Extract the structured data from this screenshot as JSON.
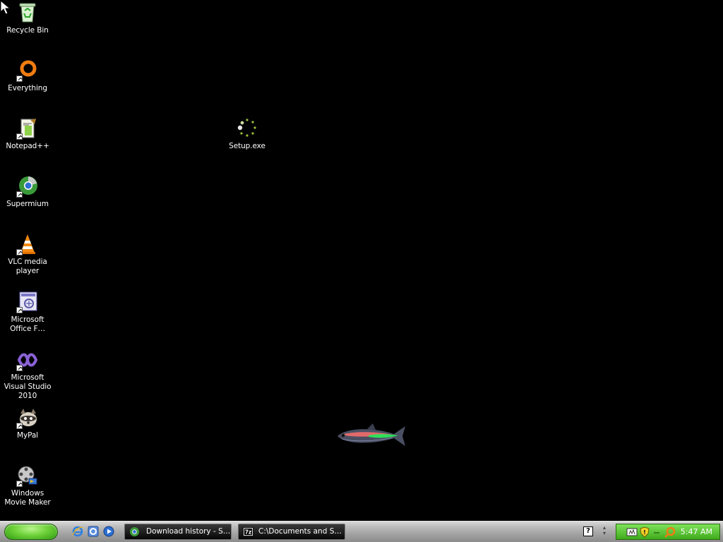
{
  "desktop": {
    "icons": [
      {
        "label": "Recycle Bin",
        "icon": "recycle-bin-icon"
      },
      {
        "label": "Everything",
        "icon": "everything-search-icon"
      },
      {
        "label": "Notepad++",
        "icon": "notepad-plus-plus-icon"
      },
      {
        "label": "Supermium",
        "icon": "supermium-browser-icon"
      },
      {
        "label": "VLC media player",
        "icon": "vlc-cone-icon"
      },
      {
        "label": "Microsoft Office F…",
        "icon": "office-frontpage-icon"
      },
      {
        "label": "Microsoft Visual Studio 2010",
        "icon": "visual-studio-icon"
      },
      {
        "label": "MyPal",
        "icon": "mypal-browser-icon"
      },
      {
        "label": "Windows Movie Maker",
        "icon": "movie-maker-icon"
      },
      {
        "label": "Setup.exe",
        "icon": "loading-spinner-icon"
      }
    ],
    "wallpaper": "neon-tetra-fish"
  },
  "taskbar": {
    "quick_launch": [
      "internet-explorer-icon",
      "ie-settings-icon",
      "media-player-icon"
    ],
    "buttons": [
      {
        "label": "Download history - S…",
        "icon": "browser-icon"
      },
      {
        "label": "C:\\Documents and S…",
        "icon": "7zip-icon"
      }
    ],
    "help_label": "?",
    "tray_icons": [
      "network-icon",
      "shield-icon",
      "search-tray-icon"
    ],
    "clock": "5:47 AM"
  },
  "colors": {
    "desktop_bg": "#000000",
    "start_green": "#4fc21f",
    "tray_green": "#5cc63a"
  }
}
